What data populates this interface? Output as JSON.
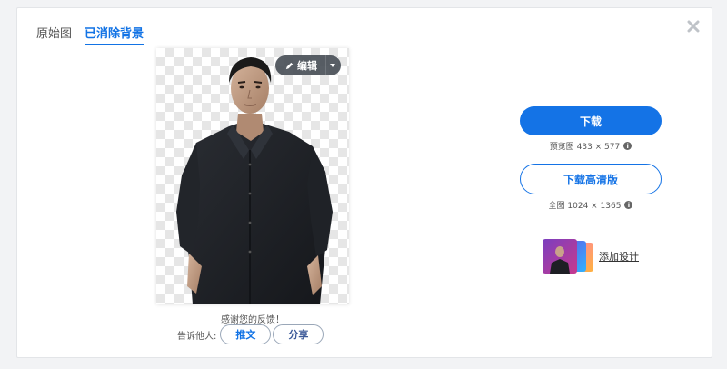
{
  "tabs": [
    {
      "label": "原始图",
      "active": false
    },
    {
      "label": "已消除背景",
      "active": true
    }
  ],
  "editor": {
    "edit_label": "编辑"
  },
  "feedback": {
    "thanks": "感谢您的反馈！",
    "share_label": "告诉他人:",
    "share_buttons": [
      "推文",
      "分享"
    ]
  },
  "download": {
    "preview_label": "下载",
    "preview_meta": "预览图 433 × 577",
    "hd_label": "下载高清版",
    "hd_meta": "全图 1024 × 1365"
  },
  "design": {
    "label": "添加设计"
  },
  "colors": {
    "accent": "#1473e6",
    "edit_bg": "#464c54"
  },
  "icons": [
    "close-icon",
    "pencil-icon",
    "caret-down-icon",
    "info-icon"
  ]
}
